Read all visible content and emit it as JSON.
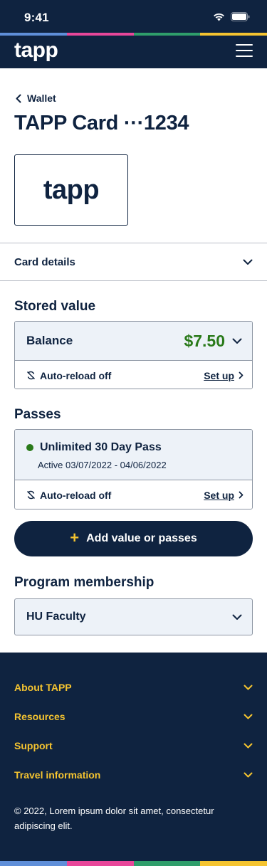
{
  "status_bar": {
    "time": "9:41"
  },
  "colors": {
    "navy": "#0f2340",
    "accent_yellow": "#f5c430",
    "balance_green": "#2a7a1a",
    "stripe": [
      "#5f8fd9",
      "#e8479a",
      "#2f9e6b",
      "#f5c430"
    ]
  },
  "header": {
    "logo": "tapp",
    "menu_icon": "hamburger-icon"
  },
  "nav": {
    "back_label": "Wallet"
  },
  "page": {
    "title": "TAPP Card ···1234",
    "card_logo": "tapp"
  },
  "card_details": {
    "label": "Card details"
  },
  "stored_value": {
    "heading": "Stored value",
    "balance_label": "Balance",
    "balance_amount": "$7.50",
    "reload_label": "Auto-reload off",
    "setup_label": "Set up"
  },
  "passes": {
    "heading": "Passes",
    "items": [
      {
        "name": "Unlimited 30 Day Pass",
        "status": "Active 03/07/2022 - 04/06/2022",
        "reload_label": "Auto-reload off",
        "setup_label": "Set up"
      }
    ]
  },
  "add_button": {
    "label": "Add value or passes"
  },
  "membership": {
    "heading": "Program membership",
    "selected": "HU Faculty"
  },
  "footer": {
    "items": [
      "About TAPP",
      "Resources",
      "Support",
      "Travel information"
    ],
    "copyright": "© 2022, Lorem ipsum dolor sit amet, consectetur adipiscing elit."
  }
}
